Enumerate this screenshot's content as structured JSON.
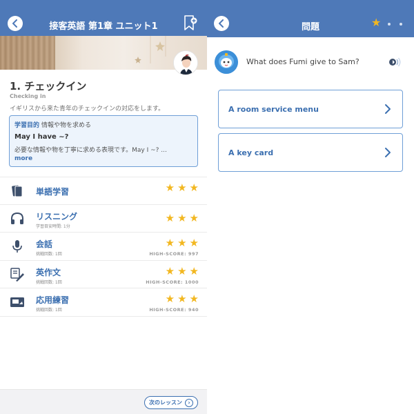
{
  "left": {
    "header": {
      "title": "接客英語 第1章 ユニット1"
    },
    "lesson": {
      "title": "1. チェックイン",
      "subtitle": "Checking in",
      "description": "イギリスから来た青年のチェックインの対応をします。"
    },
    "goal": {
      "label": "学習目的",
      "summary": "情報や物を求める",
      "phrase": "May I have ~?",
      "text": "必要な情報や物を丁寧に求める表現です。May I ~? ...",
      "more": "more"
    },
    "activities": [
      {
        "name": "単語学習",
        "meta": "",
        "high_score": "",
        "stars": 3,
        "icon": "cards-icon"
      },
      {
        "name": "リスニング",
        "meta": "学習目安時間: 1分",
        "high_score": "",
        "stars": 3,
        "icon": "headphones-icon"
      },
      {
        "name": "会話",
        "meta": "挑戦回数: 1回",
        "high_score": "HIGH-SCORE: 997",
        "stars": 3,
        "icon": "microphone-icon"
      },
      {
        "name": "英作文",
        "meta": "挑戦回数: 1回",
        "high_score": "HIGH-SCORE: 1000",
        "stars": 3,
        "icon": "pen-icon"
      },
      {
        "name": "応用練習",
        "meta": "挑戦回数: 1回",
        "high_score": "HIGH-SCORE: 940",
        "stars": 3,
        "icon": "video-card-icon"
      }
    ],
    "footer": {
      "next_label": "次のレッスン"
    }
  },
  "right": {
    "header": {
      "title": "問題"
    },
    "question": "What does Fumi give to Sam?",
    "choices": [
      {
        "label": "A room service menu"
      },
      {
        "label": "A key card"
      }
    ]
  },
  "colors": {
    "header_blue": "#4e79b8",
    "accent_blue": "#3b6fb0",
    "star_gold": "#f2b720"
  }
}
